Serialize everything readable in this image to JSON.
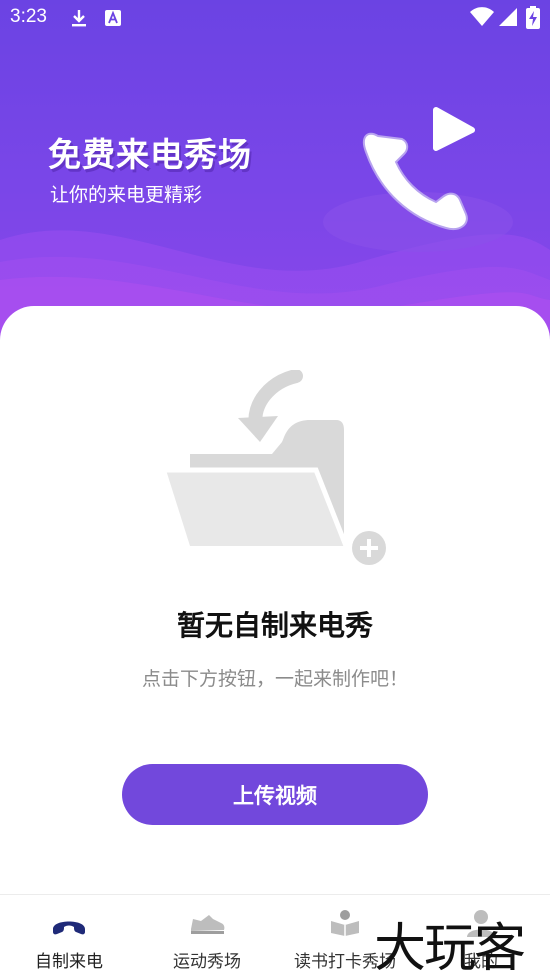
{
  "status_bar": {
    "time": "3:23",
    "icons": [
      "download-icon",
      "a-notification-icon",
      "wifi-icon",
      "signal-icon",
      "battery-charging-icon"
    ]
  },
  "hero": {
    "title": "免费来电秀场",
    "subtitle": "让你的来电更精彩",
    "illustration": "phone-call-play-icon"
  },
  "empty_state": {
    "illustration": "folder-add-icon",
    "title": "暂无自制来电秀",
    "hint": "点击下方按钮，一起来制作吧！"
  },
  "upload_button": {
    "label": "上传视频"
  },
  "tabbar": {
    "tabs": [
      {
        "label": "自制来电",
        "icon": "phone-handset-icon",
        "active": true
      },
      {
        "label": "运动秀场",
        "icon": "sneaker-icon",
        "active": false
      },
      {
        "label": "读书打卡秀场",
        "icon": "reading-book-icon",
        "active": false
      },
      {
        "label": "我的",
        "icon": "profile-icon",
        "active": false
      }
    ]
  },
  "watermark": "大玩客",
  "colors": {
    "accent": "#7248dc",
    "hero_top": "#6b43e3",
    "hero_bottom": "#8a47ea",
    "icon_grey": "#d9d9d9"
  }
}
